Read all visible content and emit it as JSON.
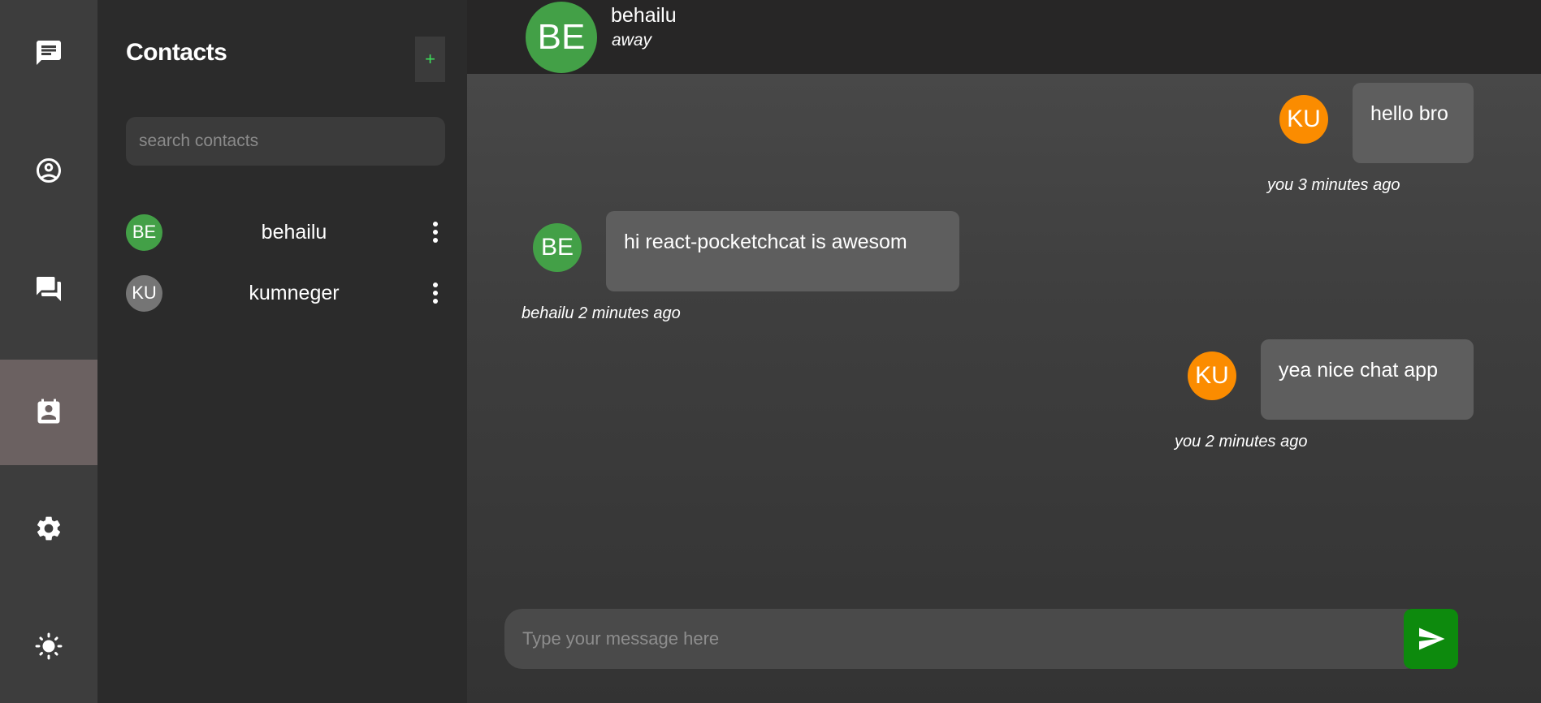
{
  "rail": {
    "items": [
      {
        "icon": "chat-bubble-icon"
      },
      {
        "icon": "user-circle-icon"
      },
      {
        "icon": "forum-icon"
      },
      {
        "icon": "contacts-icon",
        "active": true
      },
      {
        "icon": "gear-icon"
      },
      {
        "icon": "brightness-icon"
      }
    ]
  },
  "contacts": {
    "title": "Contacts",
    "add_label": "+",
    "search_placeholder": "search contacts",
    "list": [
      {
        "initials": "BE",
        "name": "behailu",
        "color": "#43a047"
      },
      {
        "initials": "KU",
        "name": "kumneger",
        "color": "#757575"
      }
    ]
  },
  "chat": {
    "header": {
      "initials": "BE",
      "name": "behailu",
      "status": "away",
      "avatar_color": "#43a047"
    },
    "messages": [
      {
        "side": "right",
        "initials": "KU",
        "avatar_color": "#fb8c00",
        "text": "hello bro",
        "meta": "you 3 minutes ago"
      },
      {
        "side": "left",
        "initials": "BE",
        "avatar_color": "#43a047",
        "text": "hi react-pocketchcat is awesom",
        "meta": "behailu 2 minutes ago"
      },
      {
        "side": "right",
        "initials": "KU",
        "avatar_color": "#fb8c00",
        "text": "yea nice chat app",
        "meta": "you 2 minutes ago"
      }
    ],
    "composer": {
      "placeholder": "Type your message here",
      "send_icon": "send-icon",
      "send_color": "#0d8a0d"
    }
  }
}
